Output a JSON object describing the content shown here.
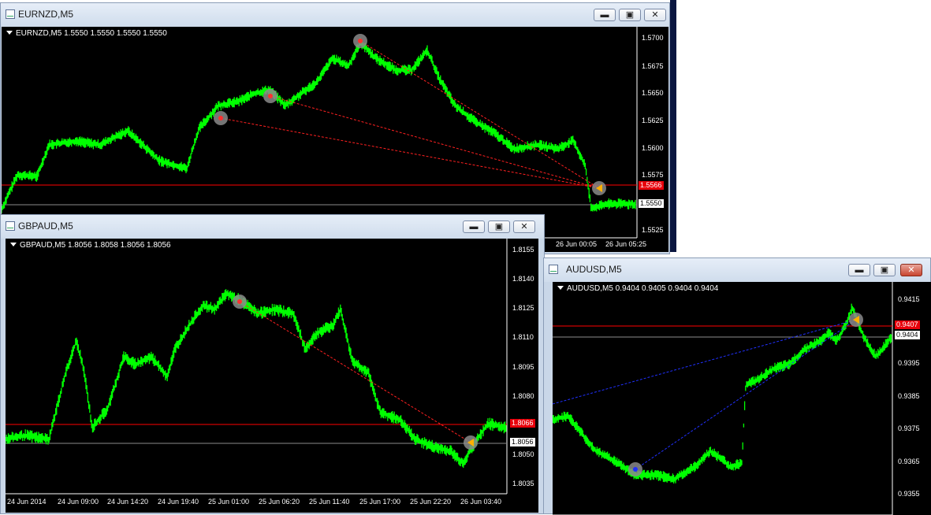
{
  "windows": {
    "eurnzd": {
      "title": "EURNZD,M5",
      "header": "EURNZD,M5  1.5550 1.5550 1.5550 1.5550",
      "price_labels": [
        "1.5700",
        "1.5675",
        "1.5650",
        "1.5625",
        "1.5600",
        "1.5575",
        "1.5525"
      ],
      "red_tag": "1.5566",
      "white_tag": "1.5550",
      "time_labels": [
        "26 Jun 00:05",
        "26 Jun 05:25"
      ]
    },
    "gbpaud": {
      "title": "GBPAUD,M5",
      "header": "GBPAUD,M5  1.8056 1.8058 1.8056 1.8056",
      "price_labels": [
        "1.8155",
        "1.8140",
        "1.8125",
        "1.8110",
        "1.8095",
        "1.8080",
        "1.8050",
        "1.8035"
      ],
      "red_tag": "1.8066",
      "white_tag": "1.8056",
      "time_labels": [
        "24 Jun 2014",
        "24 Jun 09:00",
        "24 Jun 14:20",
        "24 Jun 19:40",
        "25 Jun 01:00",
        "25 Jun 06:20",
        "25 Jun 11:40",
        "25 Jun 17:00",
        "25 Jun 22:20",
        "26 Jun 03:40"
      ]
    },
    "audusd": {
      "title": "AUDUSD,M5",
      "header": "AUDUSD,M5  0.9404 0.9405 0.9404 0.9404",
      "price_labels": [
        "0.9415",
        "0.9395",
        "0.9385",
        "0.9375",
        "0.9365",
        "0.9355"
      ],
      "red_tag": "0.9407",
      "white_tag": "0.9404"
    }
  },
  "buttons": {
    "minimize": "▬",
    "maximize": "▣",
    "close": "✕"
  },
  "colors": {
    "chart_bg": "#000000",
    "price_line": "#00ff00",
    "bid_line": "#ff0000",
    "grid_line": "#8c8c8c",
    "trend_red": "#ff2020",
    "trend_blue": "#2030ff"
  }
}
